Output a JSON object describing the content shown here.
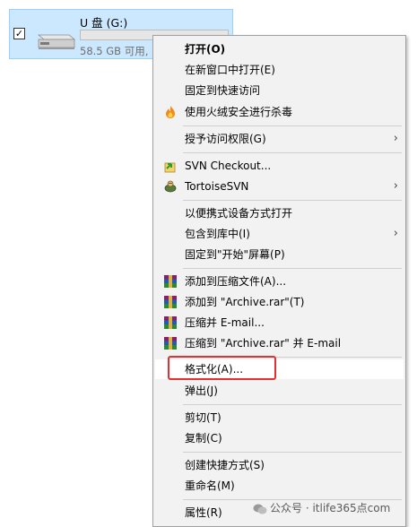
{
  "drive": {
    "checked_mark": "✓",
    "name": "U 盘 (G:)",
    "free_text": "58.5 GB 可用,",
    "used_fraction": 0.0
  },
  "menu": {
    "open": "打开(O)",
    "open_new_window": "在新窗口中打开(E)",
    "pin_quick_access": "固定到快速访问",
    "huorong_scan": "使用火绒安全进行杀毒",
    "grant_access": "授予访问权限(G)",
    "svn_checkout": "SVN Checkout...",
    "tortoise_svn": "TortoiseSVN",
    "open_portable": "以便携式设备方式打开",
    "include_library": "包含到库中(I)",
    "pin_start": "固定到\"开始\"屏幕(P)",
    "add_archive": "添加到压缩文件(A)...",
    "add_archive_rar": "添加到 \"Archive.rar\"(T)",
    "compress_email": "压缩并 E-mail...",
    "compress_rar_email": "压缩到 \"Archive.rar\" 并 E-mail",
    "format": "格式化(A)...",
    "eject": "弹出(J)",
    "cut": "剪切(T)",
    "copy": "复制(C)",
    "create_shortcut": "创建快捷方式(S)",
    "rename": "重命名(M)",
    "properties": "属性(R)",
    "submenu_arrow": "›"
  },
  "watermark": {
    "text": "公众号 · itlife365点com"
  },
  "colors": {
    "selection_bg": "#cce8ff",
    "menu_bg": "#f2f2f2",
    "highlight_box": "#e53030"
  }
}
